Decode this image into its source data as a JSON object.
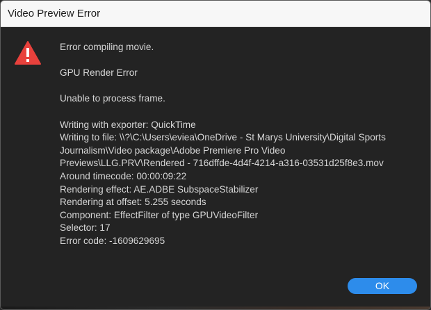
{
  "window": {
    "title": "Video Preview Error"
  },
  "icon": {
    "name": "warning-triangle-icon",
    "color": "#e8413c"
  },
  "message": {
    "heading": "Error compiling movie.",
    "error_type": "GPU Render Error",
    "summary": "Unable to process frame.",
    "details": [
      "Writing with exporter: QuickTime",
      "Writing to file: \\\\?\\C:\\Users\\eviea\\OneDrive - St Marys University\\Digital Sports",
      "Journalism\\Video package\\Adobe Premiere Pro Video",
      "Previews\\LLG.PRV\\Rendered - 716dffde-4d4f-4214-a316-03531d25f8e3.mov",
      "Around timecode: 00:00:09:22",
      "Rendering effect: AE.ADBE SubspaceStabilizer",
      "Rendering at offset: 5.255 seconds",
      "Component: EffectFilter of type GPUVideoFilter",
      "Selector: 17",
      "Error code: -1609629695"
    ]
  },
  "buttons": {
    "ok_label": "OK",
    "ok_color": "#2d8ceb"
  }
}
